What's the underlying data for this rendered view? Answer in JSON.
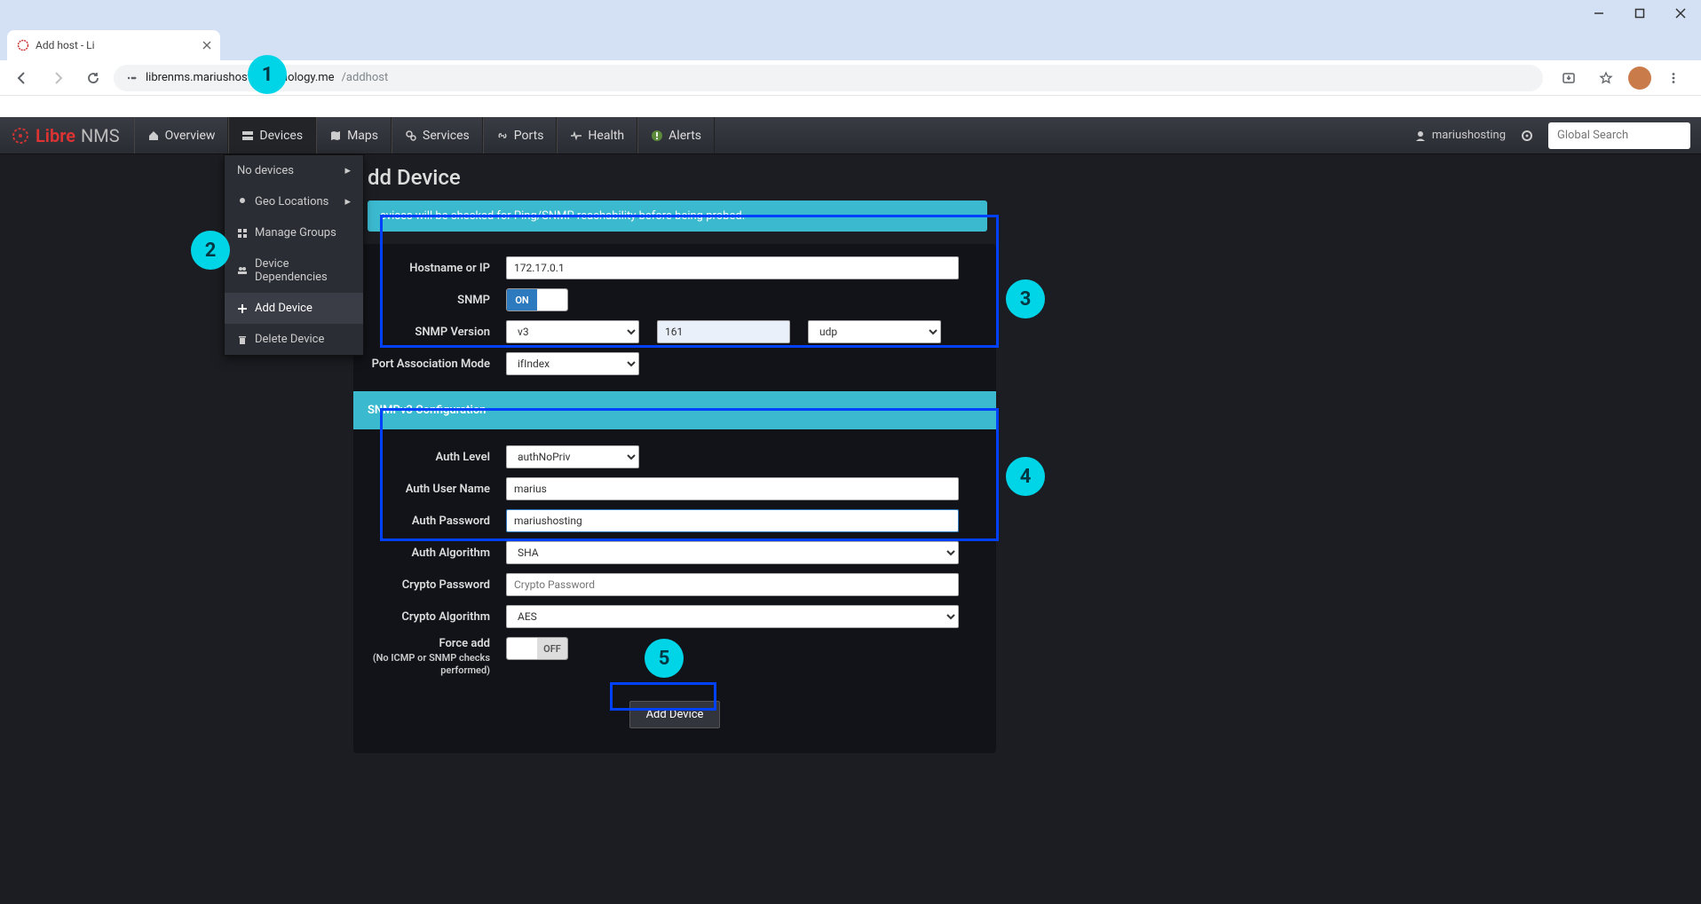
{
  "browser": {
    "tab_title": "Add host - Li",
    "url_host": "librenms.mariushosting.synology.me",
    "url_path": "/addhost"
  },
  "nav": {
    "brand_libre": "Libre",
    "brand_nms": "NMS",
    "overview": "Overview",
    "devices": "Devices",
    "maps": "Maps",
    "services": "Services",
    "ports": "Ports",
    "health": "Health",
    "alerts": "Alerts",
    "username": "mariushosting",
    "search_placeholder": "Global Search"
  },
  "dropdown": {
    "no_devices": "No devices",
    "geo_locations": "Geo Locations",
    "manage_groups": "Manage Groups",
    "device_deps": "Device Dependencies",
    "add_device": "Add Device",
    "delete_device": "Delete Device"
  },
  "page": {
    "title_partial": "dd Device",
    "info_banner": "evices will be checked for Ping/SNMP reachability before being probed.",
    "snmpv3_header": "SNMPv3 Configuration"
  },
  "form": {
    "hostname_label": "Hostname or IP",
    "hostname_value": "172.17.0.1",
    "snmp_label": "SNMP",
    "snmp_on": "ON",
    "snmp_version_label": "SNMP Version",
    "snmp_version_value": "v3",
    "snmp_port_value": "161",
    "snmp_transport_value": "udp",
    "port_assoc_label": "Port Association Mode",
    "port_assoc_value": "ifIndex",
    "auth_level_label": "Auth Level",
    "auth_level_value": "authNoPriv",
    "auth_user_label": "Auth User Name",
    "auth_user_value": "marius",
    "auth_pass_label": "Auth Password",
    "auth_pass_value": "mariushosting",
    "auth_algo_label": "Auth Algorithm",
    "auth_algo_value": "SHA",
    "crypto_pass_label": "Crypto Password",
    "crypto_pass_placeholder": "Crypto Password",
    "crypto_algo_label": "Crypto Algorithm",
    "crypto_algo_value": "AES",
    "force_add_label": "Force add",
    "force_add_sub": "(No ICMP or SNMP checks performed)",
    "force_add_off": "OFF",
    "submit_label": "Add Device"
  },
  "callouts": {
    "c1": "1",
    "c2": "2",
    "c3": "3",
    "c4": "4",
    "c5": "5"
  }
}
